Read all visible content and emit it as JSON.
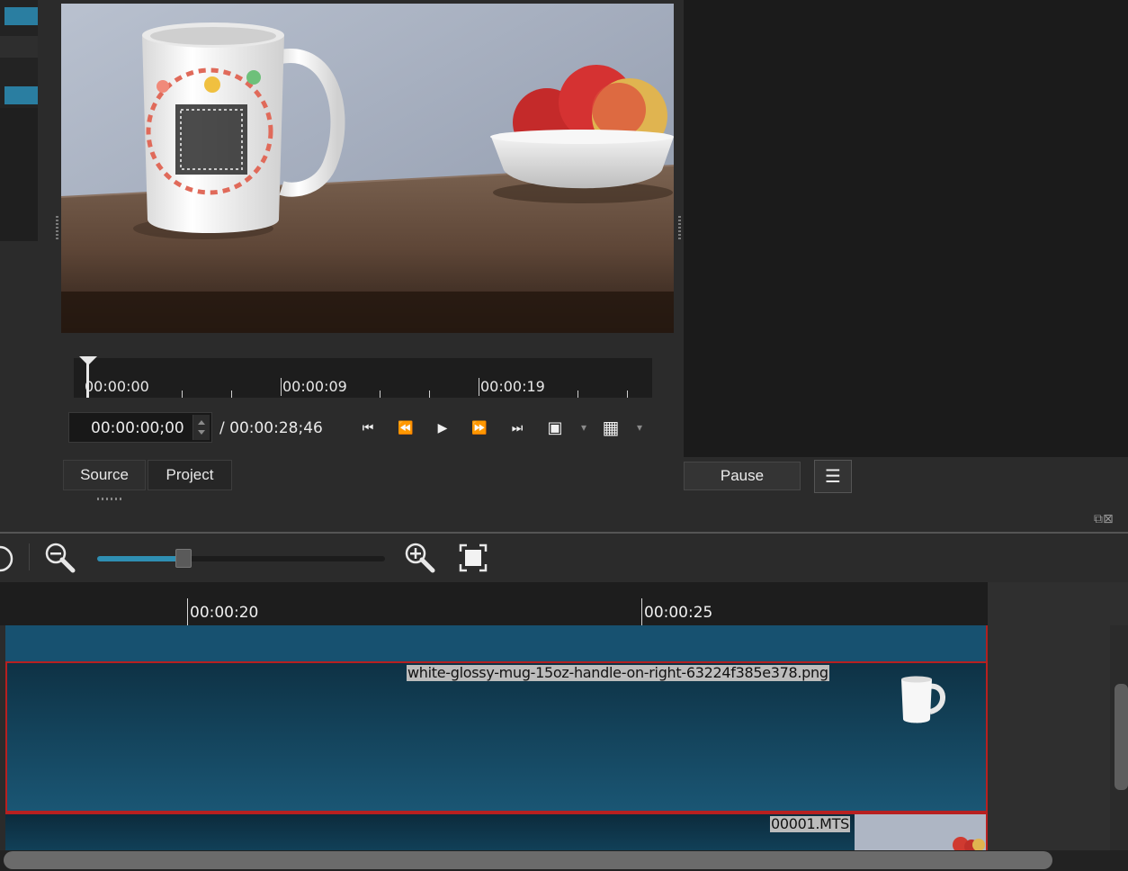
{
  "player": {
    "ruler_labels": [
      "00:00:00",
      "00:00:09",
      "00:00:19"
    ],
    "timecode": "00:00:00;00",
    "duration": "/ 00:00:28;46",
    "tabs": {
      "source": "Source",
      "project": "Project"
    }
  },
  "buttons": {
    "pause": "Pause"
  },
  "icons": {
    "skip_start": "⏮",
    "rewind": "⏪",
    "play": "▶",
    "fast_forward": "⏩",
    "skip_end": "⏭",
    "zoom_toggle": "▣",
    "grid": "▦",
    "dropdown": "▾",
    "menu": "☰",
    "zoom_out": "⊖",
    "zoom_in": "⊕",
    "zoom_fit": "⛶",
    "dock_float": "⧉",
    "dock_close": "⊠"
  },
  "timeline": {
    "zoom_level": 0.3,
    "ruler_labels": [
      "00:00:20",
      "00:00:25"
    ],
    "clips": [
      {
        "label": "white-glossy-mug-15oz-handle-on-right-63224f385e378.png"
      },
      {
        "label": "00001.MTS"
      }
    ]
  },
  "colors": {
    "accent": "#2a7ea1",
    "track": "#175170",
    "selection_border": "#b72020"
  }
}
